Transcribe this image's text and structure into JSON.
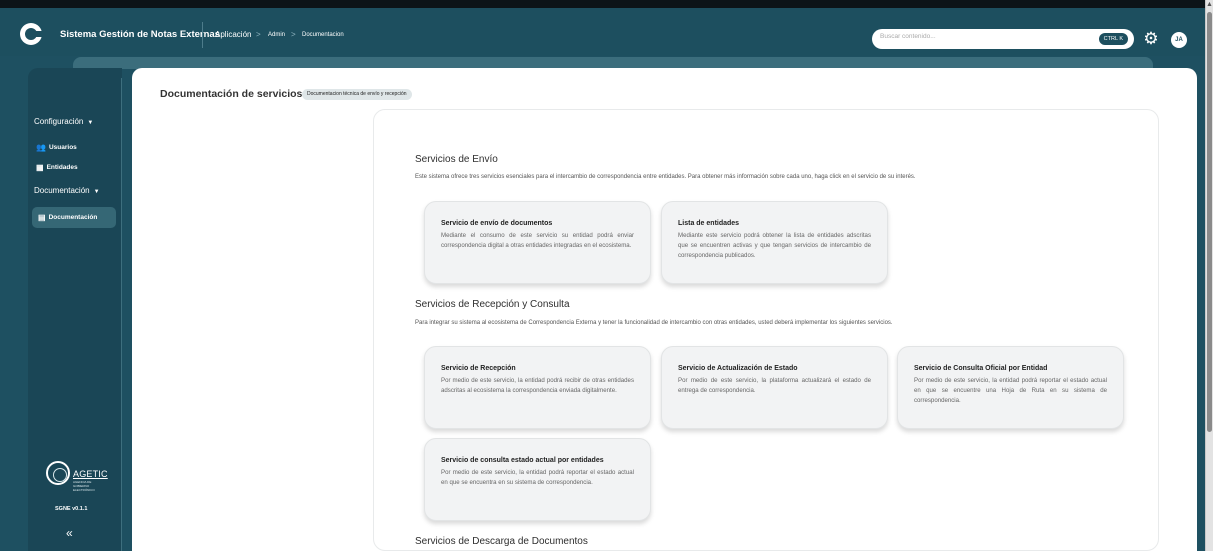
{
  "app": {
    "title": "Sistema Gestión de Notas Externas"
  },
  "breadcrumb": [
    "Aplicación",
    "Admin",
    "Documentacion"
  ],
  "breadcrumb_sep": ">",
  "search": {
    "placeholder": "Buscar contenido...",
    "shortcut": "CTRL K"
  },
  "user": {
    "initials": "JA"
  },
  "sidebar": {
    "sections": [
      {
        "label": "Configuración",
        "caret": "▼",
        "items": [
          {
            "label": "Usuarios",
            "icon": "users-icon"
          },
          {
            "label": "Entidades",
            "icon": "building-icon"
          }
        ]
      },
      {
        "label": "Documentación",
        "caret": "▼",
        "items": [
          {
            "label": "Documentación",
            "icon": "document-icon"
          }
        ]
      }
    ],
    "brand": "AGETIC",
    "brand_sub": "AGENCIA DE GOBIERNO ELECTRÓNICO",
    "version": "SGNE v0.1.1",
    "collapse": "«"
  },
  "page": {
    "title": "Documentación de servicios |",
    "subtitle": "Documentacion técnica de envío y recepción"
  },
  "sections": [
    {
      "heading": "Servicios de Envío",
      "description": "Este sistema ofrece tres servicios esenciales para el intercambio de correspondencia entre entidades. Para obtener más información sobre cada uno, haga click en el servicio de su interés.",
      "cards": [
        {
          "title": "Servicio de envío de documentos",
          "desc": "Mediante el consumo de este servicio su entidad podrá enviar correspondencia digital a otras entidades integradas en el ecosistema."
        },
        {
          "title": "Lista de entidades",
          "desc": "Mediante este servicio podrá obtener la lista de entidades adscritas que se encuentren activas y que tengan servicios de intercambio de correspondencia publicados."
        }
      ]
    },
    {
      "heading": "Servicios de Recepción y Consulta",
      "description": "Para integrar su sistema al ecosistema de Correspondencia Externa y tener la funcionalidad de intercambio con otras entidades, usted deberá implementar los siguientes servicios.",
      "cards": [
        {
          "title": "Servicio de Recepción",
          "desc": "Por medio de este servicio, la entidad podrá recibir de otras entidades adscritas al ecosistema la correspondencia enviada digitalmente."
        },
        {
          "title": "Servicio de Actualización de Estado",
          "desc": "Por medio de este servicio, la plataforma actualizará el estado de entrega de correspondencia."
        },
        {
          "title": "Servicio de Consulta Oficial por Entidad",
          "desc": "Por medio de este servicio, la entidad podrá reportar el estado actual en que se encuentre una Hoja de Ruta en su sistema de correspondencia."
        },
        {
          "title": "Servicio de consulta estado actual por entidades",
          "desc": "Por medio de este servicio, la entidad podrá reportar el estado actual en que se encuentra en su sistema de correspondencia."
        }
      ]
    },
    {
      "heading": "Servicios de Descarga de Documentos"
    }
  ]
}
